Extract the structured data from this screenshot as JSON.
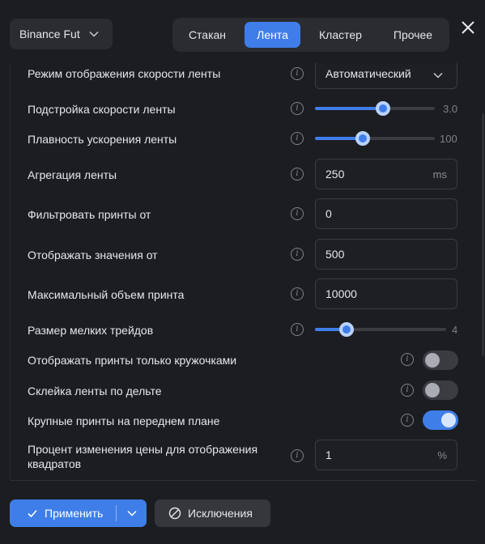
{
  "header": {
    "exchange": "Binance Fut",
    "tabs": [
      {
        "label": "Стакан",
        "active": false
      },
      {
        "label": "Лента",
        "active": true
      },
      {
        "label": "Кластер",
        "active": false
      },
      {
        "label": "Прочее",
        "active": false
      }
    ],
    "close_icon": "close-icon"
  },
  "settings": {
    "speed_mode": {
      "label": "Режим отображения скорости ленты",
      "value": "Автоматический"
    },
    "speed_tune": {
      "label": "Подстройка скорости ленты",
      "value": "3.0",
      "fraction": 0.57
    },
    "accel_smooth": {
      "label": "Плавность ускорения ленты",
      "value": "100",
      "fraction": 0.4
    },
    "aggregation": {
      "label": "Агрегация ленты",
      "value": "250",
      "unit": "ms"
    },
    "filter_prints": {
      "label": "Фильтровать принты от",
      "value": "0"
    },
    "show_values": {
      "label": "Отображать значения от",
      "value": "500"
    },
    "max_print": {
      "label": "Максимальный объем принта",
      "value": "10000"
    },
    "small_trades": {
      "label": "Размер мелких трейдов",
      "value": "4",
      "fraction": 0.24
    },
    "circles_only": {
      "label": "Отображать принты только кружочками",
      "on": false
    },
    "delta_glue": {
      "label": "Склейка ленты по дельте",
      "on": false
    },
    "big_front": {
      "label": "Крупные принты на переднем плане",
      "on": true
    },
    "squares_percent": {
      "label_line1": "Процент изменения цены для отображения",
      "label_line2": "квадратов",
      "value": "1",
      "unit": "%"
    }
  },
  "footer": {
    "apply_label": "Применить",
    "exclusions_label": "Исключения"
  },
  "colors": {
    "accent": "#3f7ee8",
    "background": "#1c1d21"
  }
}
